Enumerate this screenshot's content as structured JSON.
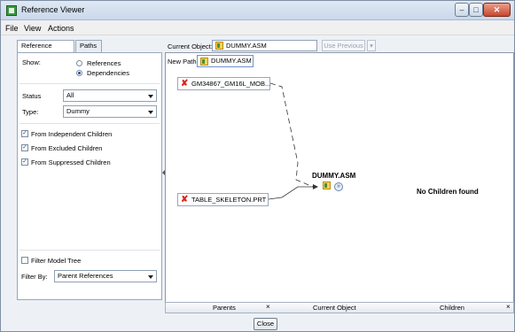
{
  "window": {
    "title": "Reference Viewer"
  },
  "menu": {
    "items": [
      "File",
      "View",
      "Actions"
    ]
  },
  "tabs": {
    "reference_filters": "Reference Filters",
    "paths": "Paths"
  },
  "filters": {
    "show_label": "Show:",
    "show_options": [
      "References",
      "Dependencies"
    ],
    "show_selected": "Dependencies",
    "status_label": "Status",
    "status_value": "All",
    "type_label": "Type:",
    "type_value": "Dummy",
    "checkboxes": [
      {
        "label": "From Independent Children",
        "checked": true
      },
      {
        "label": "From Excluded Children",
        "checked": true
      },
      {
        "label": "From Suppressed Children",
        "checked": true
      }
    ],
    "filter_model_tree": {
      "label": "Filter Model Tree",
      "checked": false
    },
    "filter_by_label": "Filter By:",
    "filter_by_value": "Parent References"
  },
  "current_object": {
    "label": "Current Object:",
    "value": "DUMMY.ASM",
    "use_previous": "Use Previous"
  },
  "graph": {
    "new_path_label": "New Path:",
    "new_path_value": "DUMMY.ASM",
    "parents": [
      "GM34867_GM16L_MOB...",
      "TABLE_SKELETON.PRT"
    ],
    "current": "DUMMY.ASM",
    "children_text": "No Children found"
  },
  "columns": {
    "parents": "Parents",
    "current": "Current Object",
    "children": "Children",
    "close_glyph": "×"
  },
  "footer": {
    "close": "Close"
  },
  "colors": {
    "accent": "#1d4e9c",
    "error": "#d6261b"
  }
}
